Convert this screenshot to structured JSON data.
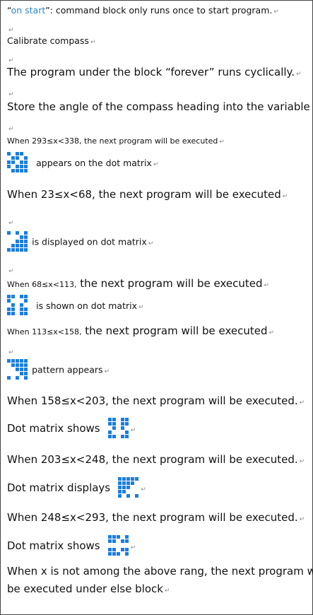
{
  "line1": {
    "prefix": "“",
    "highlight": "on start",
    "rest": "”: command block only runs once to start program."
  },
  "line2": "Calibrate compass",
  "line3": "The program under the block “forever” runs cyclically.",
  "line4": "Store the angle of the compass heading into the variable x",
  "line5": "When 293≤x<338,  the next program will be executed",
  "line6": "appears on the dot matrix",
  "line7": "When 23≤x<68,  the next program will be executed",
  "line8": "is displayed on dot matrix",
  "line9": {
    "small": "When 68≤x<113,",
    "large": " the next program will be executed"
  },
  "line10": "is shown on dot matrix",
  "line11": {
    "small": "When 113≤x<158,",
    "large": "  the next program will be executed"
  },
  "line12": "pattern appears",
  "line13": "When 158≤x<203, the next program will be executed.",
  "line14": "Dot matrix shows",
  "line15": "When 203≤x<248,    the next program will be executed.",
  "line16": "Dot matrix displays",
  "line17": "When 248≤x<293, the next program will be executed.",
  "line18": "Dot matrix shows",
  "line19a": "When x is not among the above rang, the next program will",
  "line19b": "be executed under else block",
  "matrices": {
    "m1": [
      [
        1,
        0,
        1,
        1,
        0
      ],
      [
        0,
        1,
        1,
        0,
        1
      ],
      [
        1,
        1,
        0,
        1,
        1
      ],
      [
        1,
        0,
        1,
        1,
        1
      ],
      [
        0,
        1,
        1,
        1,
        1
      ]
    ],
    "m2": [
      [
        1,
        0,
        1,
        0,
        1
      ],
      [
        0,
        0,
        0,
        1,
        1
      ],
      [
        0,
        0,
        1,
        1,
        1
      ],
      [
        0,
        1,
        1,
        1,
        1
      ],
      [
        1,
        1,
        1,
        1,
        1
      ]
    ],
    "m3": [
      [
        1,
        1,
        0,
        1,
        1
      ],
      [
        1,
        0,
        0,
        0,
        1
      ],
      [
        0,
        1,
        0,
        1,
        0
      ],
      [
        1,
        1,
        0,
        1,
        1
      ],
      [
        1,
        1,
        0,
        1,
        1
      ]
    ],
    "m4": [
      [
        1,
        1,
        1,
        1,
        1
      ],
      [
        0,
        1,
        1,
        1,
        1
      ],
      [
        0,
        0,
        1,
        1,
        1
      ],
      [
        0,
        0,
        0,
        1,
        1
      ],
      [
        1,
        0,
        1,
        0,
        1
      ]
    ],
    "m5": [
      [
        1,
        1,
        0,
        1,
        1
      ],
      [
        1,
        1,
        0,
        1,
        1
      ],
      [
        0,
        1,
        0,
        1,
        0
      ],
      [
        1,
        0,
        0,
        0,
        1
      ],
      [
        1,
        1,
        0,
        1,
        1
      ]
    ],
    "m6": [
      [
        1,
        1,
        1,
        1,
        1
      ],
      [
        1,
        1,
        1,
        1,
        0
      ],
      [
        1,
        1,
        1,
        0,
        0
      ],
      [
        1,
        1,
        0,
        0,
        0
      ],
      [
        1,
        0,
        1,
        0,
        1
      ]
    ],
    "m7": [
      [
        1,
        1,
        1,
        0,
        1
      ],
      [
        1,
        1,
        0,
        1,
        1
      ],
      [
        0,
        0,
        0,
        0,
        0
      ],
      [
        1,
        1,
        0,
        1,
        1
      ],
      [
        1,
        1,
        1,
        0,
        1
      ]
    ]
  }
}
